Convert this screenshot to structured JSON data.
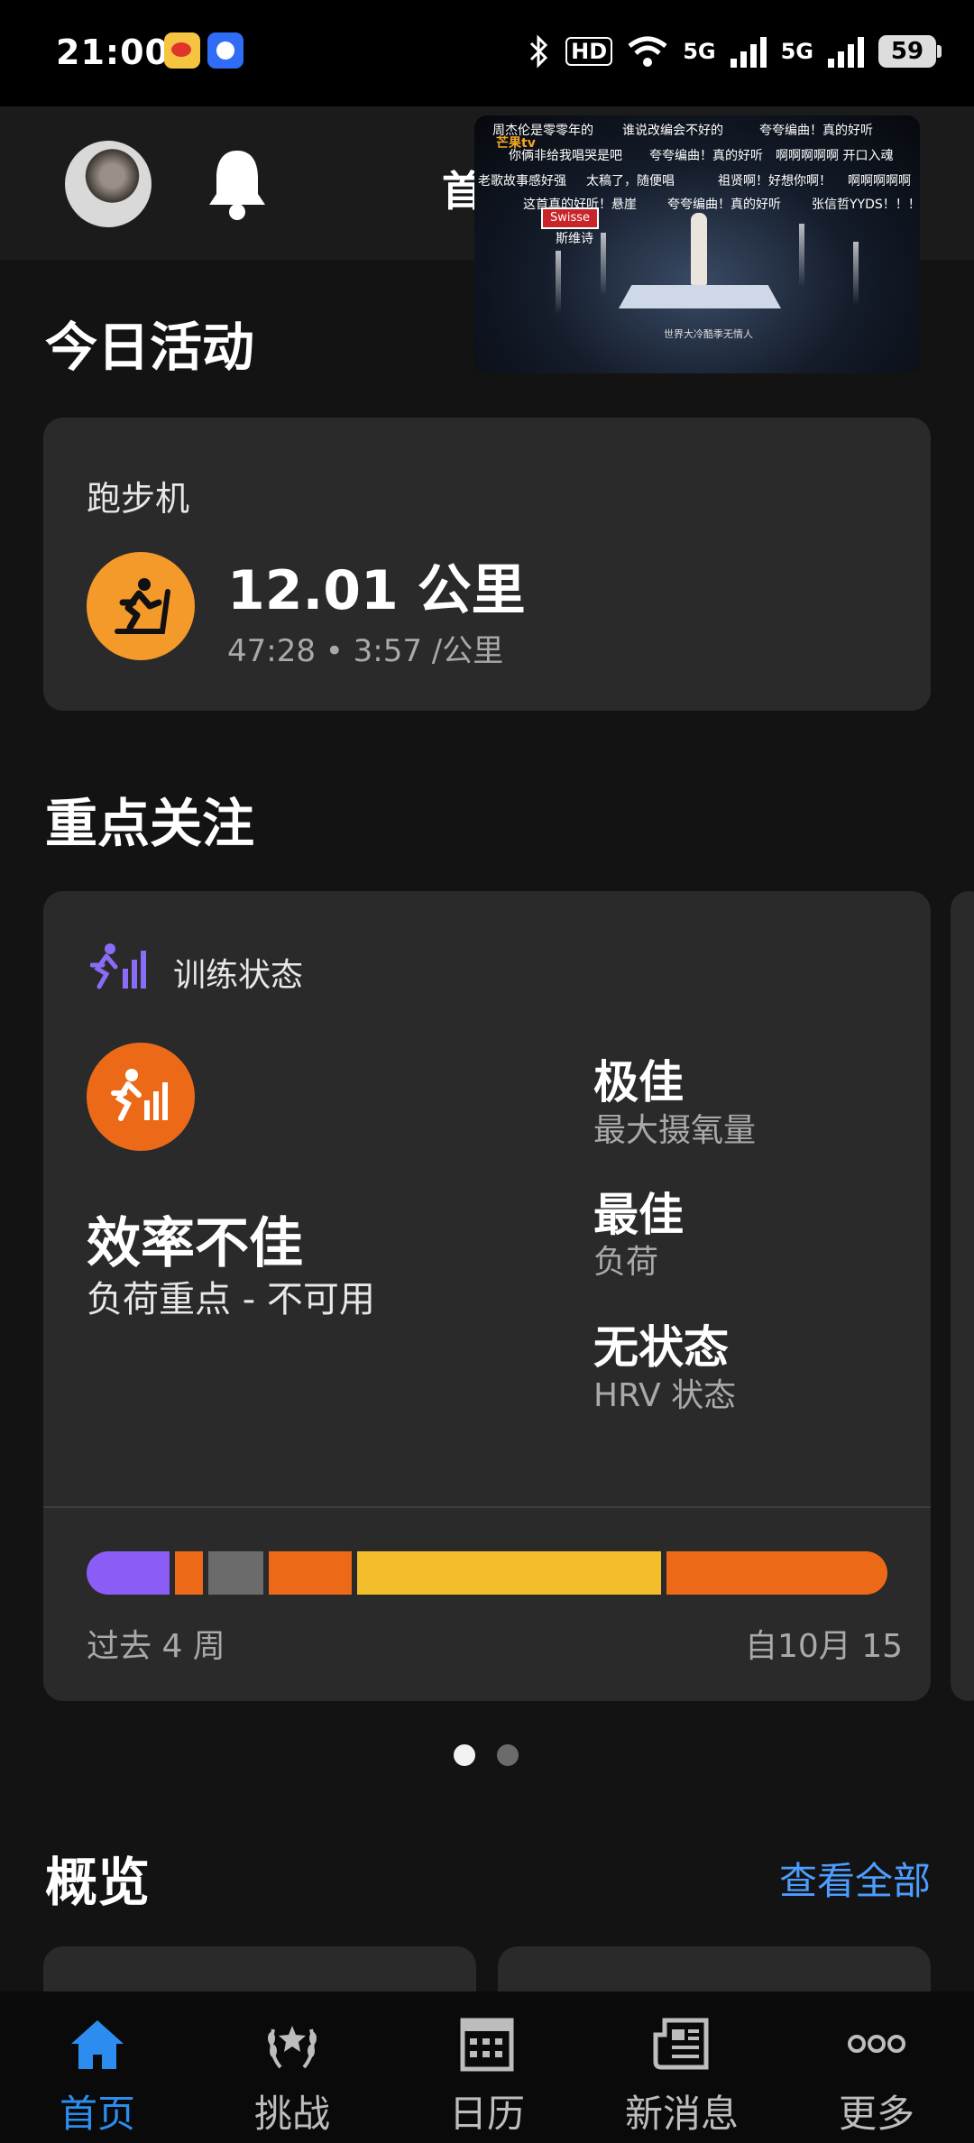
{
  "status_bar": {
    "time": "21:00",
    "hd_label": "HD",
    "net1": "5G",
    "net2": "5G",
    "battery": "59"
  },
  "header": {
    "title_partial": "首"
  },
  "video_overlay": {
    "danmaku": [
      "周杰伦是零零年的",
      "谁说改编会不好的",
      "夸夸编曲！真的好听",
      "你俩非给我唱哭是吧",
      "夸夸编曲！真的好听",
      "啊啊啊啊啊 开口入魂",
      "老歌故事感好强",
      "太稿了，随便唱",
      "祖贤啊！好想你啊！",
      "啊啊啊啊啊",
      "这首真的好听！悬崖",
      "夸夸编曲！真的好听",
      "张信哲YYDS！！！"
    ],
    "channel_logo": "芒果tv",
    "sponsor": "Swisse",
    "caption": "斯维诗",
    "subtitle": "世界大冷酷季无情人"
  },
  "today": {
    "title": "今日活动",
    "activity": {
      "type": "跑步机",
      "distance": "12.01 公里",
      "detail": "47:28 • 3:57 /公里",
      "icon": "treadmill-icon",
      "color": "#F39A2A"
    }
  },
  "focus": {
    "title": "重点关注",
    "training": {
      "label": "训练状态",
      "status": "效率不佳",
      "sub": "负荷重点 - 不可用",
      "status_color": "#EC6A17",
      "metrics": [
        {
          "value": "极佳",
          "label": "最大摄氧量"
        },
        {
          "value": "最佳",
          "label": "负荷"
        },
        {
          "value": "无状态",
          "label": "HRV 状态"
        }
      ],
      "history_left": "过去 4 周",
      "history_right": "自10月 15",
      "history_segments": [
        {
          "color": "#8B5CF6",
          "weight": 60
        },
        {
          "color": "#EC6A17",
          "weight": 20
        },
        {
          "color": "#6B6B6B",
          "weight": 40
        },
        {
          "color": "#EC6A17",
          "weight": 60
        },
        {
          "color": "#F2BE2C",
          "weight": 220
        },
        {
          "color": "#EC6A17",
          "weight": 160
        }
      ]
    }
  },
  "pagination": {
    "current": 1,
    "total": 2
  },
  "overview": {
    "title": "概览",
    "view_all": "查看全部"
  },
  "nav": {
    "items": [
      {
        "label": "首页",
        "icon": "home-icon",
        "active": true
      },
      {
        "label": "挑战",
        "icon": "laurel-icon",
        "active": false
      },
      {
        "label": "日历",
        "icon": "calendar-icon",
        "active": false
      },
      {
        "label": "新消息",
        "icon": "news-icon",
        "active": false
      },
      {
        "label": "更多",
        "icon": "more-icon",
        "active": false
      }
    ]
  }
}
